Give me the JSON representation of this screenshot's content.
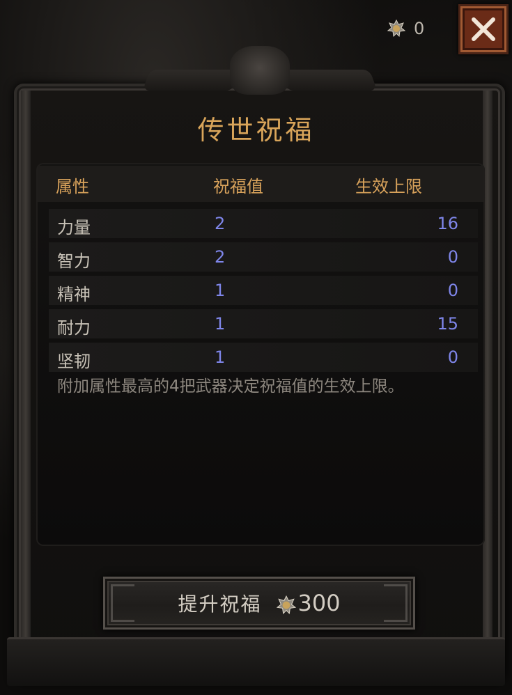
{
  "currency": {
    "icon": "gem-currency-icon",
    "count": "0"
  },
  "close": {
    "icon": "close-icon"
  },
  "panel": {
    "title": "传世祝福",
    "headers": {
      "attribute": "属性",
      "blessing_value": "祝福值",
      "effective_cap": "生效上限"
    },
    "rows": [
      {
        "name": "力量",
        "value": "2",
        "cap": "16"
      },
      {
        "name": "智力",
        "value": "2",
        "cap": "0"
      },
      {
        "name": "精神",
        "value": "1",
        "cap": "0"
      },
      {
        "name": "耐力",
        "value": "1",
        "cap": "15"
      },
      {
        "name": "坚韧",
        "value": "1",
        "cap": "0"
      }
    ],
    "note": "附加属性最高的4把武器决定祝福值的生效上限。"
  },
  "upgrade": {
    "label": "提升祝福",
    "cost": "300",
    "icon": "gem-currency-icon"
  },
  "colors": {
    "gold": "#d9a55a",
    "value_blue": "#7f86ea",
    "close_red": "#6a2b17"
  }
}
